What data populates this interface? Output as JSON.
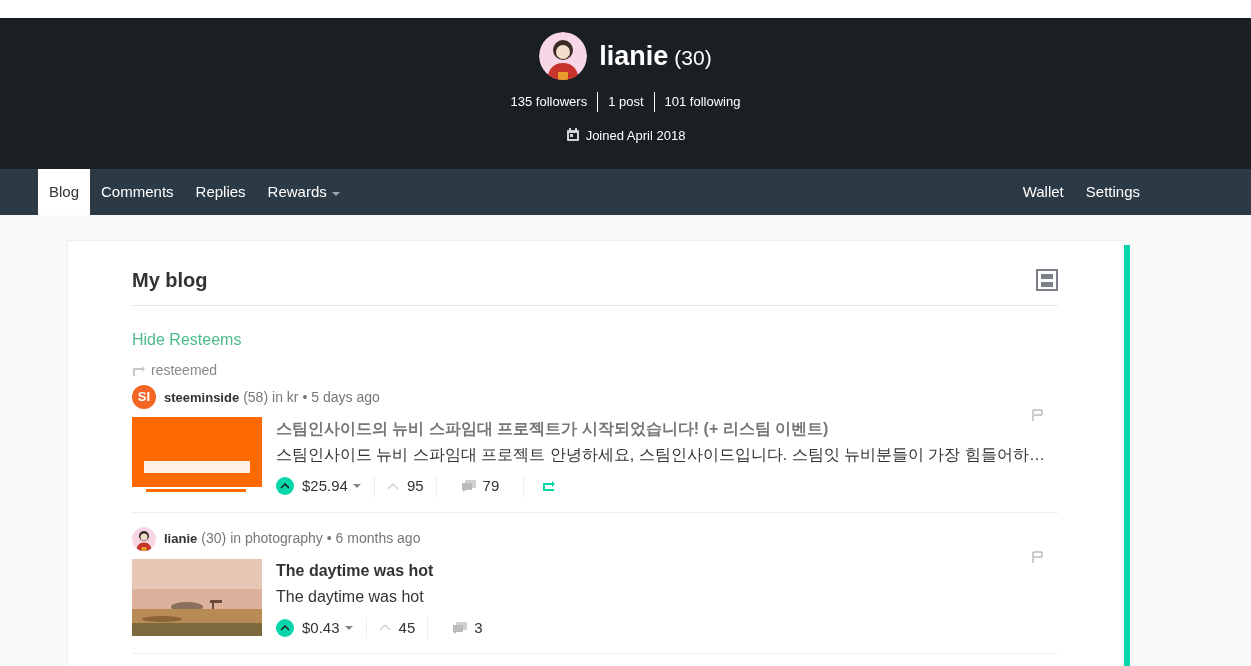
{
  "profile": {
    "name": "lianie",
    "reputation": "(30)",
    "stats": [
      "135 followers",
      "1 post",
      "101 following"
    ],
    "joined": "Joined April 2018"
  },
  "nav": {
    "left": [
      {
        "label": "Blog",
        "selected": true,
        "dropdown": false
      },
      {
        "label": "Comments",
        "selected": false,
        "dropdown": false
      },
      {
        "label": "Replies",
        "selected": false,
        "dropdown": false
      },
      {
        "label": "Rewards",
        "selected": false,
        "dropdown": true
      }
    ],
    "right": [
      {
        "label": "Wallet",
        "selected": false
      },
      {
        "label": "Settings",
        "selected": false
      }
    ]
  },
  "blog": {
    "title": "My blog",
    "toggle": "Hide Resteems",
    "posts": [
      {
        "resteemed": true,
        "resteem_label": "resteemed",
        "avatar_text": "SI",
        "author": "steeminside",
        "reputation": "(58)",
        "category": "in kr",
        "time": "• 5 days ago",
        "title": "스팀인사이드의 뉴비 스파임대 프로젝트가 시작되었습니다! (+ 리스팀 이벤트)",
        "title_dim": true,
        "summary": "스팀인사이드 뉴비 스파임대 프로젝트 안녕하세요, 스팀인사이드입니다. 스팀잇 뉴비분들이 가장 힘들어하…",
        "voted": true,
        "payout": "$25.94",
        "votes": "95",
        "comments": "79",
        "can_resteem": true
      },
      {
        "resteemed": false,
        "author": "lianie",
        "reputation": "(30)",
        "category": "in photography",
        "time": "• 6 months ago",
        "title": "The daytime was hot",
        "title_dim": false,
        "summary": "The daytime was hot",
        "voted": true,
        "payout": "$0.43",
        "votes": "45",
        "comments": "3",
        "can_resteem": false
      }
    ]
  }
}
